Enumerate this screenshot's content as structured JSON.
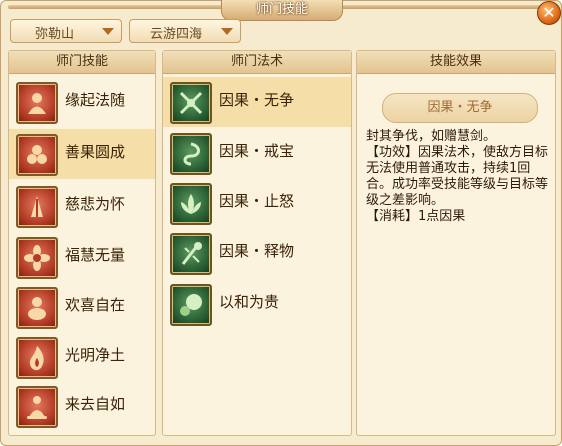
{
  "window": {
    "title": "师门技能",
    "close_symbol": "✕"
  },
  "filters": {
    "sect": "弥勒山",
    "category": "云游四海"
  },
  "skills": {
    "header": "师门技能",
    "items": [
      {
        "label": "缘起法随",
        "icon": "monk-figure-icon"
      },
      {
        "label": "善果圆成",
        "icon": "offering-fruits-icon",
        "selected": true
      },
      {
        "label": "慈悲为怀",
        "icon": "praying-hands-icon"
      },
      {
        "label": "福慧无量",
        "icon": "lotus-flower-icon"
      },
      {
        "label": "欢喜自在",
        "icon": "laughing-buddha-icon"
      },
      {
        "label": "光明净土",
        "icon": "flame-icon"
      },
      {
        "label": "来去自如",
        "icon": "meditating-figure-icon"
      }
    ]
  },
  "spells": {
    "header": "师门法术",
    "items": [
      {
        "label": "因果・无争",
        "icon": "crossed-swords-icon",
        "selected": true
      },
      {
        "label": "因果・戒宝",
        "icon": "treasure-swirl-icon"
      },
      {
        "label": "因果・止怒",
        "icon": "lotus-calm-icon"
      },
      {
        "label": "因果・释物",
        "icon": "released-staff-icon"
      },
      {
        "label": "以和为贵",
        "icon": "harmony-orbs-icon"
      }
    ]
  },
  "effect": {
    "header": "技能效果",
    "name": "因果・无争",
    "lines": [
      "封其争伐，如赠慧剑。",
      "【功效】因果法术，使敌方目标无法使用普通攻击，持续1回合。成功率受技能等级与目标等级之差影响。",
      "【消耗】1点因果"
    ]
  }
}
